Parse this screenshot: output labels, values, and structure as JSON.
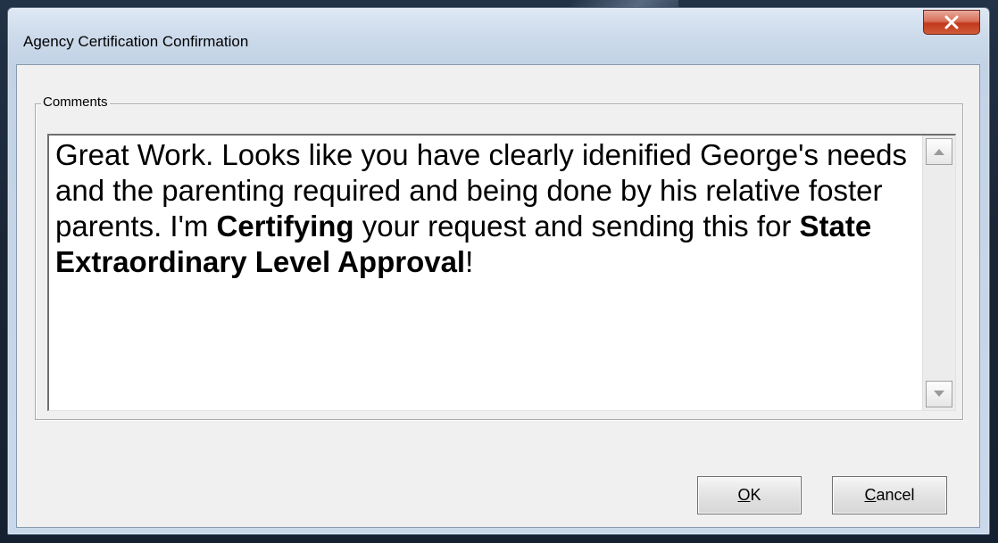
{
  "window": {
    "title": "Agency Certification Confirmation",
    "close_glyph": "X"
  },
  "comments": {
    "group_label": "Comments",
    "text_segments": [
      {
        "text": "Great Work. Looks like you have clearly idenified George's needs and the parenting required and being done by his relative foster parents. I'm ",
        "bold": false
      },
      {
        "text": "Certifying",
        "bold": true
      },
      {
        "text": " your request and sending this for ",
        "bold": false
      },
      {
        "text": "State Extraordinary Level Approval",
        "bold": true
      },
      {
        "text": "!",
        "bold": false
      }
    ]
  },
  "buttons": {
    "ok": {
      "mnemonic": "O",
      "rest": "K"
    },
    "cancel": {
      "mnemonic": "C",
      "rest": "ancel"
    }
  },
  "colors": {
    "close_button": "#c2391c",
    "window_frame": "#c3d3e6",
    "dialog_background": "#f0f0f0"
  },
  "icons": {
    "close": "close-icon",
    "scroll_up": "scroll-up-arrow-icon",
    "scroll_down": "scroll-down-arrow-icon"
  }
}
